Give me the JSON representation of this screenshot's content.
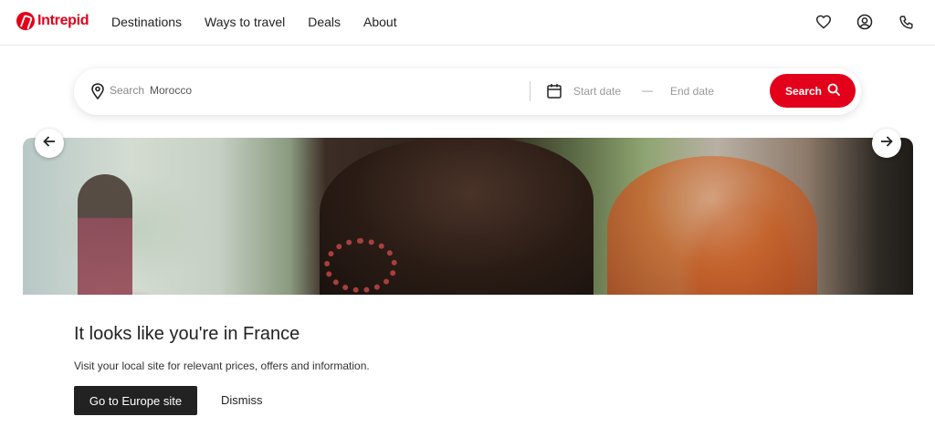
{
  "header": {
    "logo_text": "Intrepid",
    "nav": [
      "Destinations",
      "Ways to travel",
      "Deals",
      "About"
    ],
    "icons": [
      "heart-icon",
      "account-icon",
      "phone-icon"
    ]
  },
  "search": {
    "prefix": "Search",
    "value": "Morocco",
    "start_date_placeholder": "Start date",
    "dash": "—",
    "end_date_placeholder": "End date",
    "button_label": "Search"
  },
  "hero": {
    "prev_icon": "arrow-left-icon",
    "next_icon": "arrow-right-icon"
  },
  "location_prompt": {
    "title": "It looks like you're in France",
    "text": "Visit your local site for relevant prices, offers and information.",
    "primary_button": "Go to Europe site",
    "secondary_button": "Dismiss"
  },
  "colors": {
    "brand": "#e2001a",
    "dark_button": "#222222"
  }
}
